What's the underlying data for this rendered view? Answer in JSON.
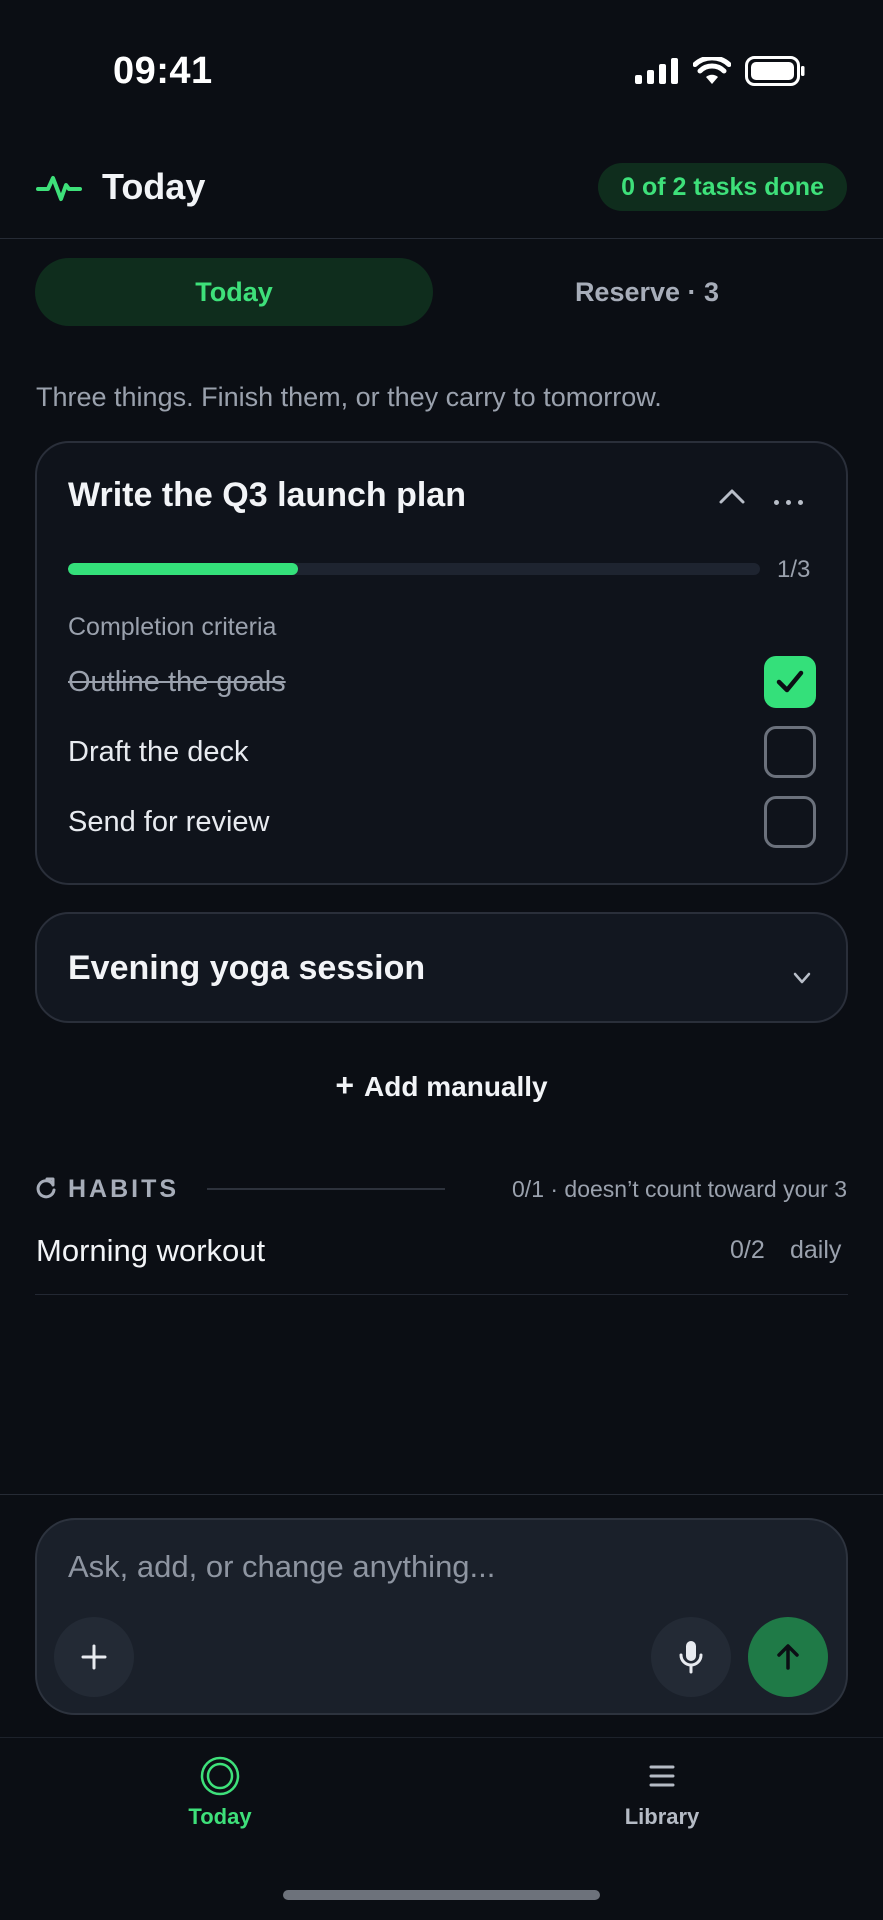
{
  "status_bar": {
    "time": "09:41",
    "icons": [
      "cellular-icon",
      "wifi-icon",
      "battery-icon"
    ]
  },
  "header": {
    "icon": "pulse-icon",
    "title": "Today",
    "tasks_done_badge": "0 of 2 tasks done"
  },
  "tabs": [
    {
      "label": "Today",
      "selected": true
    },
    {
      "label": "Reserve · 3",
      "selected": false
    }
  ],
  "subtitle": "Three things. Finish them, or they carry to tomorrow.",
  "tasks": [
    {
      "title": "Write the Q3 launch plan",
      "expanded": true,
      "progress_text": "1/3",
      "progress_fraction": 0.333,
      "criteria_label": "Completion criteria",
      "criteria": [
        {
          "text": "Outline the goals",
          "done": true
        },
        {
          "text": "Draft the deck",
          "done": false
        },
        {
          "text": "Send for review",
          "done": false
        }
      ]
    },
    {
      "title": "Evening yoga session",
      "expanded": false
    }
  ],
  "add_manually": {
    "plus": "+",
    "label": "Add manually"
  },
  "habits": {
    "icon": "refresh-icon",
    "label": "HABITS",
    "note": "0/1 · doesn’t count toward your 3",
    "items": [
      {
        "name": "Morning workout",
        "progress": "0/2",
        "frequency": "daily"
      }
    ]
  },
  "composer": {
    "placeholder": "Ask, add, or change anything..."
  },
  "bottom_nav": [
    {
      "label": "Today",
      "icon": "target-icon",
      "active": true
    },
    {
      "label": "Library",
      "icon": "menu-icon",
      "active": false
    }
  ],
  "colors": {
    "background": "#0b0e14",
    "accent": "#34e07a",
    "accent_dark": "#0f2d1d",
    "send_button": "#1f7a47"
  }
}
